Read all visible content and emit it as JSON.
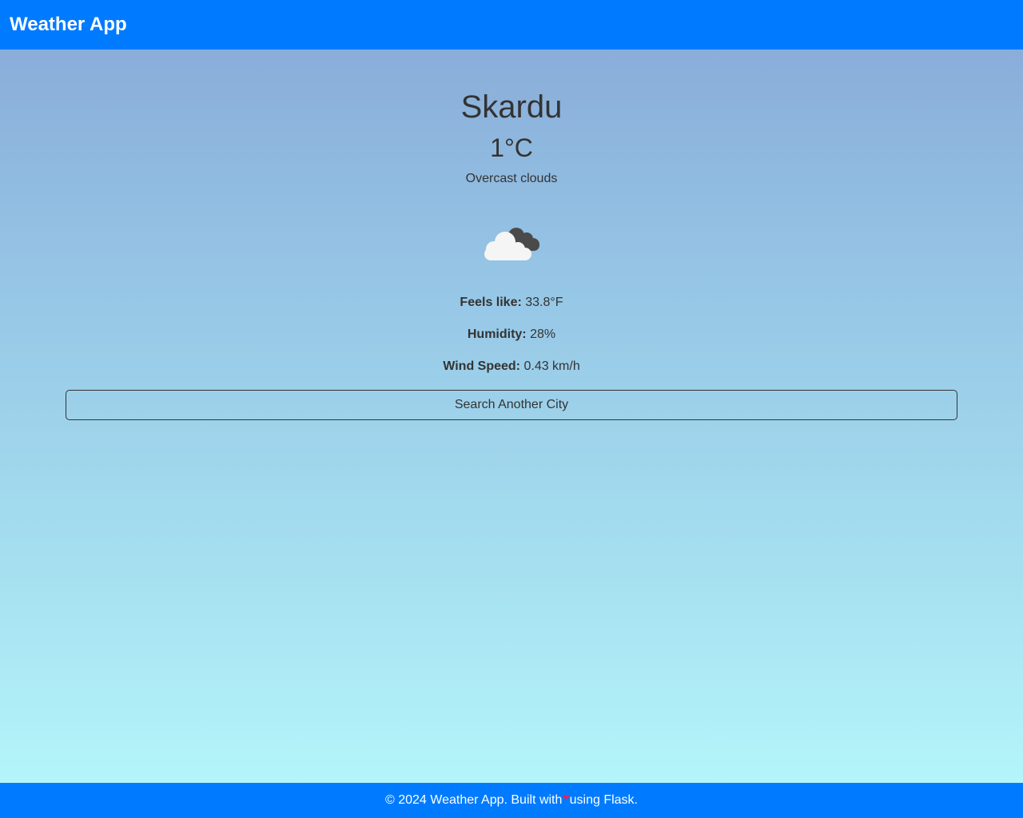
{
  "navbar": {
    "brand": "Weather App"
  },
  "weather": {
    "city": "Skardu",
    "temperature": "1°C",
    "description": "Overcast clouds",
    "icon": "overcast-clouds-icon"
  },
  "details": {
    "feels_like_label": "Feels like:",
    "feels_like_value": "33.8°F",
    "humidity_label": "Humidity:",
    "humidity_value": "28%",
    "wind_label": "Wind Speed:",
    "wind_value": "0.43 km/h"
  },
  "actions": {
    "search_label": "Search Another City"
  },
  "footer": {
    "text_before": "© 2024 Weather App. Built with",
    "heart_icon": "heart-icon",
    "text_after": "using Flask."
  },
  "colors": {
    "primary": "#007bff",
    "text": "#333333",
    "heart": "#e0245e"
  }
}
